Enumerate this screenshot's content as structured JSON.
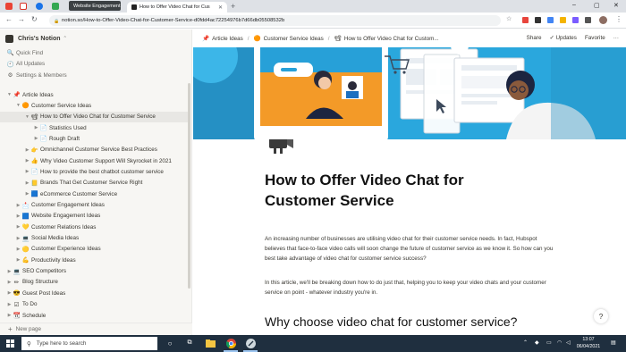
{
  "browser": {
    "tooltip_tab": "Website Engagement",
    "active_tab": "How to Offer Video Chat for Cus",
    "url": "notion.so/How-to-Offer-Video-Chat-for-Customer-Service-d0fdd4ac72254976b7d66db05508532b"
  },
  "sidebar": {
    "workspace": "Chris's Notion",
    "quick_links": [
      {
        "icon": "🔍",
        "label": "Quick Find"
      },
      {
        "icon": "🕘",
        "label": "All Updates"
      },
      {
        "icon": "⚙",
        "label": "Settings & Members"
      }
    ],
    "tree": [
      {
        "indent": 0,
        "tw": "▼",
        "icon": "📌",
        "label": "Article Ideas"
      },
      {
        "indent": 1,
        "tw": "▼",
        "icon": "🟠",
        "label": "Customer Service Ideas"
      },
      {
        "indent": 2,
        "tw": "▼",
        "icon": "📽",
        "label": "How to Offer Video Chat for Customer Service",
        "selected": true
      },
      {
        "indent": 3,
        "tw": "▶",
        "icon": "📄",
        "label": "Statistics Used"
      },
      {
        "indent": 3,
        "tw": "▶",
        "icon": "📄",
        "label": "Rough Draft"
      },
      {
        "indent": 2,
        "tw": "▶",
        "icon": "👉",
        "label": "Omnichannel Customer Service Best Practices"
      },
      {
        "indent": 2,
        "tw": "▶",
        "icon": "👍",
        "label": "Why Video Customer Support Will Skyrocket in 2021"
      },
      {
        "indent": 2,
        "tw": "▶",
        "icon": "📄",
        "label": "How to provide the best chatbot customer service"
      },
      {
        "indent": 2,
        "tw": "▶",
        "icon": "📒",
        "label": "Brands That Get Customer Service Right"
      },
      {
        "indent": 2,
        "tw": "▶",
        "icon": "🟦",
        "label": "eCommerce Customer Service"
      },
      {
        "indent": 1,
        "tw": "▶",
        "icon": "📩",
        "label": "Customer Engagement Ideas"
      },
      {
        "indent": 1,
        "tw": "▶",
        "icon": "🟦",
        "label": "Website Engagement Ideas"
      },
      {
        "indent": 1,
        "tw": "▶",
        "icon": "💛",
        "label": "Customer Relations Ideas"
      },
      {
        "indent": 1,
        "tw": "▶",
        "icon": "💻",
        "label": "Social Media Ideas"
      },
      {
        "indent": 1,
        "tw": "▶",
        "icon": "🟡",
        "label": "Customer Experience Ideas"
      },
      {
        "indent": 1,
        "tw": "▶",
        "icon": "💪",
        "label": "Productivity Ideas"
      },
      {
        "indent": 0,
        "tw": "▶",
        "icon": "💻",
        "label": "SEO Competitors"
      },
      {
        "indent": 0,
        "tw": "▶",
        "icon": "✏",
        "label": "Blog Structure"
      },
      {
        "indent": 0,
        "tw": "▶",
        "icon": "😎",
        "label": "Guest Post Ideas"
      },
      {
        "indent": 0,
        "tw": "▶",
        "icon": "☑",
        "label": "To Do"
      },
      {
        "indent": 0,
        "tw": "▶",
        "icon": "📆",
        "label": "Schedule"
      }
    ],
    "new_page": "New page"
  },
  "topbar": {
    "crumbs": [
      {
        "icon": "📌",
        "label": "Article Ideas"
      },
      {
        "icon": "🟠",
        "label": "Customer Service Ideas"
      },
      {
        "icon": "📽",
        "label": "How to Offer Video Chat for Custom..."
      }
    ],
    "share": "Share",
    "updates": "Updates",
    "favorite": "Favorite",
    "more": "···"
  },
  "page": {
    "title": "How to Offer Video Chat for Customer Service",
    "paragraph_1": "An increasing number of businesses are utilising video chat for their customer service needs. In fact, Hubspot believes that face-to-face video calls will soon change the future of customer service as we know it. So how can you best take advantage of video chat for customer service success?",
    "paragraph_2": "In this article, we'll be breaking down how to do just that, helping you to keep your video chats and your customer service on point - whatever industry you're in.",
    "heading_2": "Why choose video chat for customer service?",
    "help": "?"
  },
  "taskbar": {
    "search_placeholder": "Type here to search",
    "time": "13:07",
    "date": "06/04/2021"
  },
  "colors": {
    "cover_blue": "#2aa7dd",
    "taskbar": "#1f2f3f",
    "sidebar_bg": "#f7f6f3"
  }
}
